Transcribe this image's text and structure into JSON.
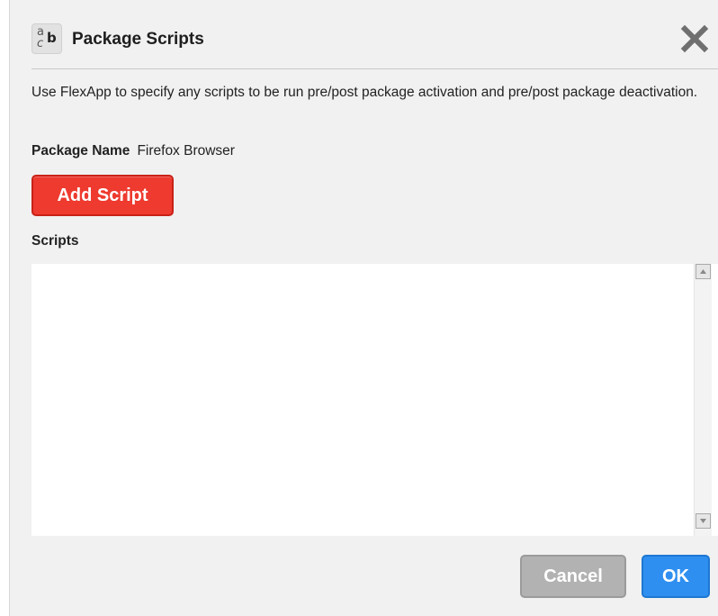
{
  "dialog": {
    "title": "Package Scripts",
    "title_icon": "text-abc-icon",
    "close_icon": "close-icon",
    "description": "Use FlexApp to specify any scripts to be run pre/post package activation and pre/post package deactivation.",
    "package_name_label": "Package Name",
    "package_name_value": "Firefox Browser",
    "add_script_label": "Add Script",
    "scripts_label": "Scripts",
    "scripts": [],
    "cancel_label": "Cancel",
    "ok_label": "OK"
  },
  "colors": {
    "add_button": "#ee3a2f",
    "cancel_button": "#b2b2b2",
    "ok_button": "#2f8ff0",
    "dialog_background": "#f1f1f1"
  }
}
